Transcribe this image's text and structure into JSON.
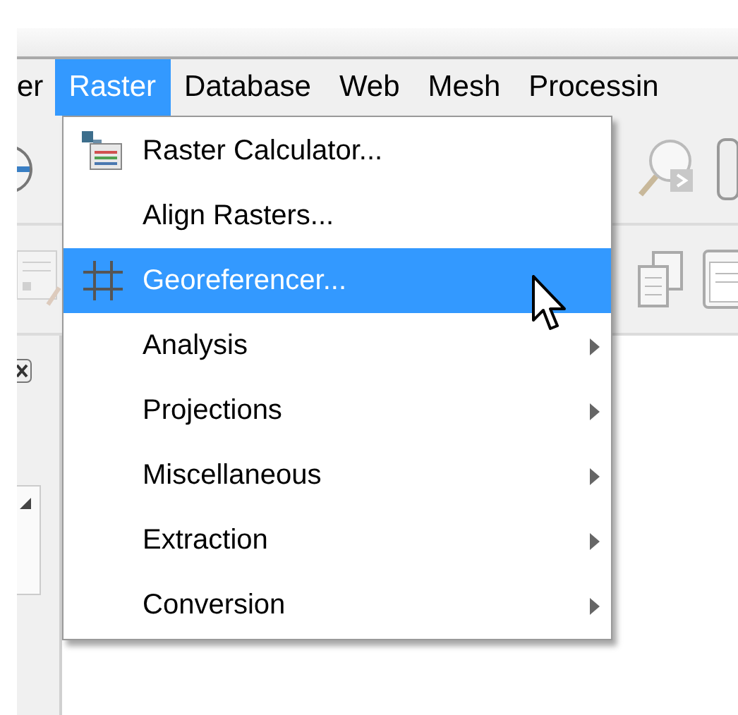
{
  "menubar": {
    "items": [
      {
        "label": "er",
        "selected": false
      },
      {
        "label": "Raster",
        "selected": true
      },
      {
        "label": "Database",
        "selected": false
      },
      {
        "label": "Web",
        "selected": false
      },
      {
        "label": "Mesh",
        "selected": false
      },
      {
        "label": "Processin",
        "selected": false
      }
    ]
  },
  "dropdown": {
    "items": [
      {
        "label": "Raster Calculator...",
        "kind": "calculator",
        "selected": false
      },
      {
        "label": "Align Rasters...",
        "kind": "action",
        "selected": false
      },
      {
        "label": "Georeferencer...",
        "kind": "grid",
        "selected": true
      },
      {
        "label": "Analysis",
        "kind": "submenu",
        "selected": false
      },
      {
        "label": "Projections",
        "kind": "submenu",
        "selected": false
      },
      {
        "label": "Miscellaneous",
        "kind": "submenu",
        "selected": false
      },
      {
        "label": "Extraction",
        "kind": "submenu",
        "selected": false
      },
      {
        "label": "Conversion",
        "kind": "submenu",
        "selected": false
      }
    ]
  }
}
